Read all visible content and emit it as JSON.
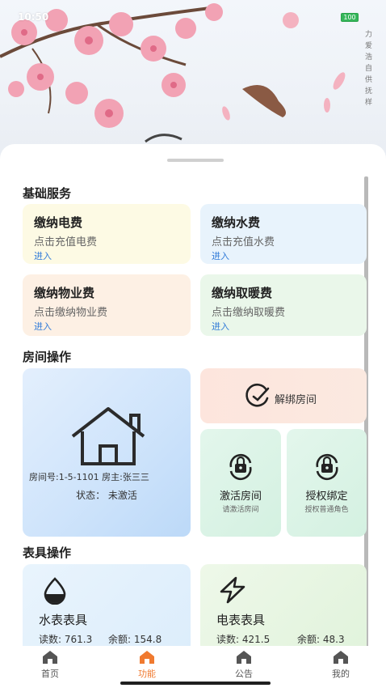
{
  "status": {
    "time": "10:50",
    "battery": "100"
  },
  "hero_text": "力 爱 浩 自 供 抚 样",
  "sections": {
    "basic": "基础服务",
    "room": "房间操作",
    "meter": "表具操作"
  },
  "services": [
    {
      "title": "缴纳电费",
      "sub": "点击充值电费",
      "link": "进入",
      "bg": "#fdfae4"
    },
    {
      "title": "缴纳水费",
      "sub": "点击充值水费",
      "link": "进入",
      "bg": "#e8f3fc"
    },
    {
      "title": "缴纳物业费",
      "sub": "点击缴纳物业费",
      "link": "进入",
      "bg": "#fdf0e4"
    },
    {
      "title": "缴纳取暖费",
      "sub": "点击缴纳取暖费",
      "link": "进入",
      "bg": "#eaf7ea"
    }
  ],
  "room": {
    "info": "房间号:1-5-1101    房主:张三三",
    "status": "状态：  未激活",
    "unbind": "解绑房间",
    "activate": "激活房间",
    "activate_sub": "请激活房间",
    "authorize": "授权绑定",
    "authorize_sub": "授权普通角色"
  },
  "meters": {
    "water": {
      "title": "水表表具",
      "reading": "读数: 761.3",
      "balance": "余额: 154.8"
    },
    "electric": {
      "title": "电表表具",
      "reading": "读数: 421.5",
      "balance": "余额: 48.3"
    }
  },
  "tabs": [
    {
      "label": "首页",
      "icon": "home-icon"
    },
    {
      "label": "功能",
      "icon": "function-icon"
    },
    {
      "label": "公告",
      "icon": "announcement-icon"
    },
    {
      "label": "我的",
      "icon": "profile-icon"
    }
  ],
  "colors": {
    "accent": "#f07a30",
    "link": "#2f7ad8"
  }
}
